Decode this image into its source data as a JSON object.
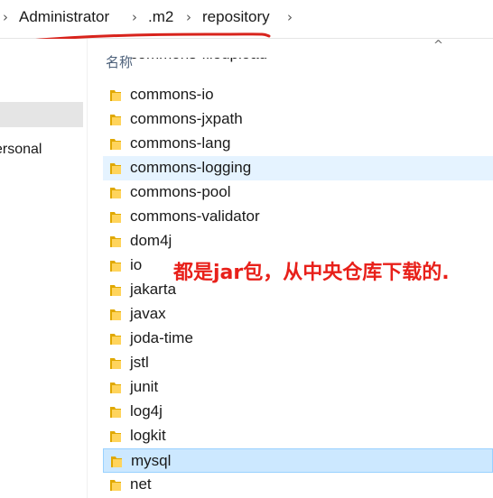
{
  "breadcrumb": {
    "items": [
      "Administrator",
      ".m2",
      "repository"
    ],
    "separator": "›"
  },
  "nav": {
    "partial_label": "ersonal"
  },
  "list": {
    "column_header": "名称",
    "partial_top_item": "commons-fileupload",
    "items": [
      {
        "name": "commons-io",
        "state": "normal"
      },
      {
        "name": "commons-jxpath",
        "state": "normal"
      },
      {
        "name": "commons-lang",
        "state": "normal"
      },
      {
        "name": "commons-logging",
        "state": "hover"
      },
      {
        "name": "commons-pool",
        "state": "normal"
      },
      {
        "name": "commons-validator",
        "state": "normal"
      },
      {
        "name": "dom4j",
        "state": "normal"
      },
      {
        "name": "io",
        "state": "normal"
      },
      {
        "name": "jakarta",
        "state": "normal"
      },
      {
        "name": "javax",
        "state": "normal"
      },
      {
        "name": "joda-time",
        "state": "normal"
      },
      {
        "name": "jstl",
        "state": "normal"
      },
      {
        "name": "junit",
        "state": "normal"
      },
      {
        "name": "log4j",
        "state": "normal"
      },
      {
        "name": "logkit",
        "state": "normal"
      },
      {
        "name": "mysql",
        "state": "selected"
      },
      {
        "name": "net",
        "state": "normal"
      }
    ]
  },
  "annotation": {
    "text": "都是jar包，从中央仓库下载的."
  },
  "colors": {
    "hover_bg": "#e5f3ff",
    "selected_bg": "#cce8ff",
    "selected_border": "#99d1ff",
    "folder_yellow": "#ffd45c",
    "annotation_red": "#e8201a"
  }
}
